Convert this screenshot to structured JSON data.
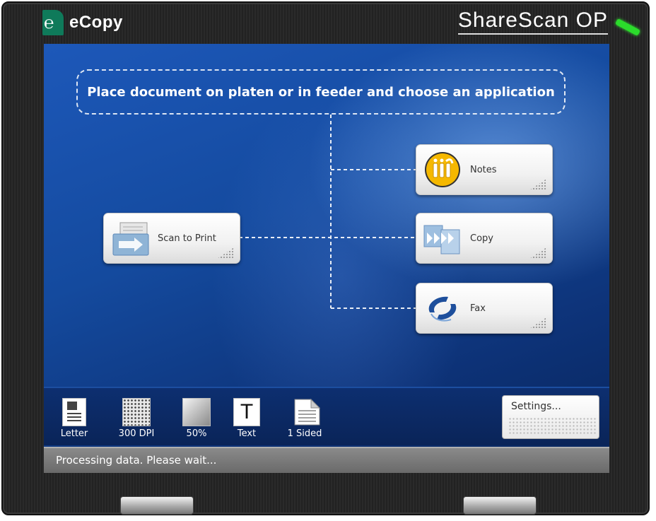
{
  "header": {
    "logo_text": "eCopy",
    "brand": "ShareScan OP"
  },
  "instruction": "Place document on platen or in feeder and choose an application",
  "apps": {
    "source": {
      "label": "Scan to Print",
      "icon": "scan-to-print-icon"
    },
    "destinations": [
      {
        "label": "Notes",
        "icon": "notes-icon"
      },
      {
        "label": "Copy",
        "icon": "copy-icon"
      },
      {
        "label": "Fax",
        "icon": "fax-icon"
      }
    ]
  },
  "scan_options": [
    {
      "label": "Letter",
      "icon": "letter-page-icon"
    },
    {
      "label": "300 DPI",
      "icon": "dpi-icon"
    },
    {
      "label": "50%",
      "icon": "brightness-icon"
    },
    {
      "label": "Text",
      "icon": "text-mode-icon"
    },
    {
      "label": "1 Sided",
      "icon": "one-sided-icon"
    }
  ],
  "settings_button": "Settings...",
  "status_text": "Processing data. Please wait...",
  "colors": {
    "screen_blue": "#144a9e",
    "led_green": "#2bdc2b",
    "notes_yellow": "#f5b800",
    "fax_blue": "#1e4f9c"
  }
}
